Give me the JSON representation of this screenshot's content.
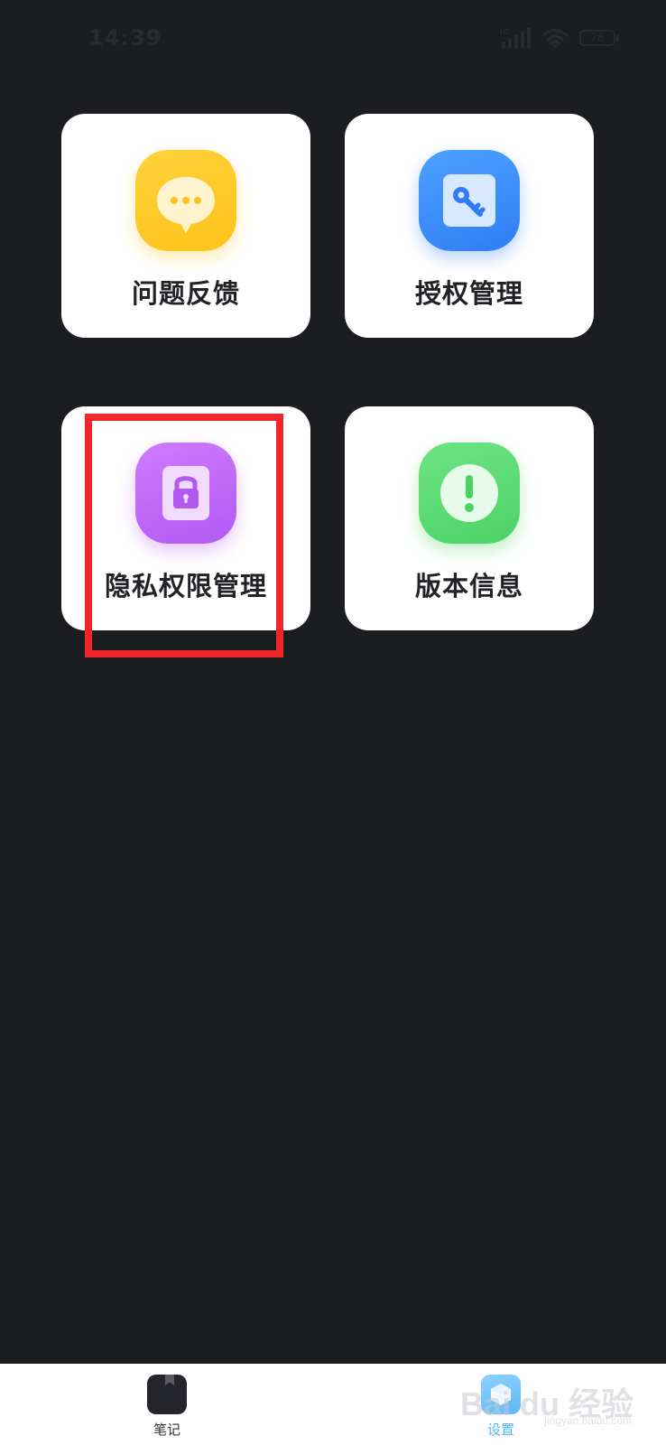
{
  "status_bar": {
    "time": "14:39",
    "battery_level": "78",
    "network_label": "HD"
  },
  "cards": {
    "feedback": {
      "label": "问题反馈",
      "icon": "chat-bubble-icon",
      "color": "#ffc21a"
    },
    "auth": {
      "label": "授权管理",
      "icon": "key-icon",
      "color": "#2f7df6"
    },
    "privacy": {
      "label": "隐私权限管理",
      "icon": "lock-icon",
      "color": "#b259f2"
    },
    "version": {
      "label": "版本信息",
      "icon": "exclamation-icon",
      "color": "#4cd365"
    }
  },
  "annotation": {
    "color": "#f0262a"
  },
  "bottom_nav": {
    "notes_label": "笔记",
    "settings_label": "设置",
    "active_color": "#52b4f5"
  },
  "watermark": {
    "logo": "Bai du 经验",
    "url": "jingyan.baidu.com"
  }
}
